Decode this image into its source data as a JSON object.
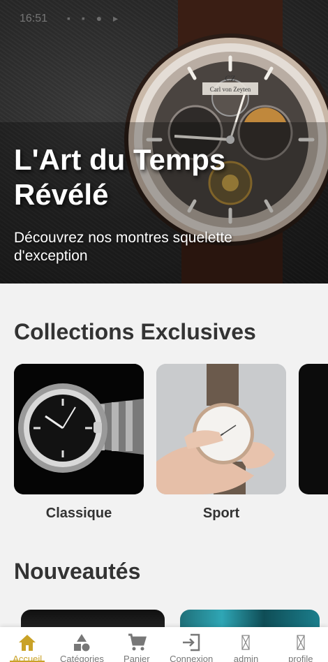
{
  "status_bar": {
    "time": "16:51",
    "icons": "▪ ▪ ● ▸"
  },
  "hero": {
    "title": "L'Art du Temps Révélé",
    "subtitle": "Découvrez nos montres squelette d'exception",
    "watch_brand": "Carl von Zeyten",
    "watch_monogram": "CZ"
  },
  "collections": {
    "title": "Collections Exclusives",
    "items": [
      {
        "label": "Classique"
      },
      {
        "label": "Sport"
      }
    ]
  },
  "new_arrivals": {
    "title": "Nouveautés"
  },
  "bottom_nav": {
    "items": [
      {
        "label": "Accueil",
        "icon": "home-icon",
        "active": true
      },
      {
        "label": "Catégories",
        "icon": "categories-icon"
      },
      {
        "label": "Panier",
        "icon": "cart-icon"
      },
      {
        "label": "Connexion",
        "icon": "login-icon"
      },
      {
        "label": "admin",
        "icon": "broken-image-icon"
      },
      {
        "label": "profile",
        "icon": "broken-image-icon"
      }
    ],
    "active_color": "#c9a227"
  }
}
